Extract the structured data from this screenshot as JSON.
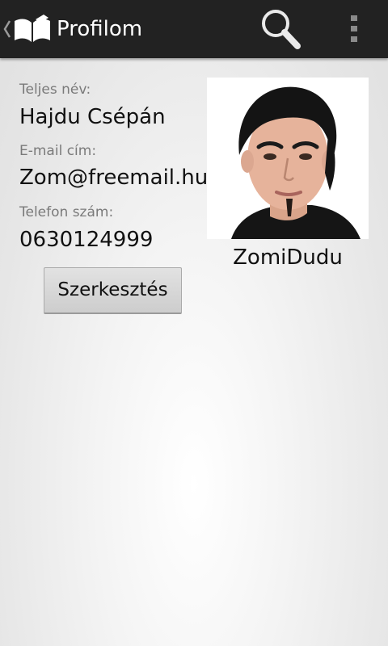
{
  "action_bar": {
    "title": "Profilom",
    "app_icon": "open-book-icon",
    "up_icon": "chevron-left-icon",
    "search_icon": "search-icon",
    "overflow_icon": "overflow-menu-icon"
  },
  "profile": {
    "name_label": "Teljes név:",
    "name_value": "Hajdu Csépán",
    "email_label": "E-mail cím:",
    "email_value": "Zom@freemail.hu",
    "phone_label": "Telefon szám:",
    "phone_value": "0630124999",
    "username": "ZomiDudu"
  },
  "edit_button": {
    "label": "Szerkesztés"
  },
  "colors": {
    "action_bar_bg": "#222222",
    "title_text": "#ffffff",
    "label_text": "#7a7a7a",
    "value_text": "#111111"
  }
}
